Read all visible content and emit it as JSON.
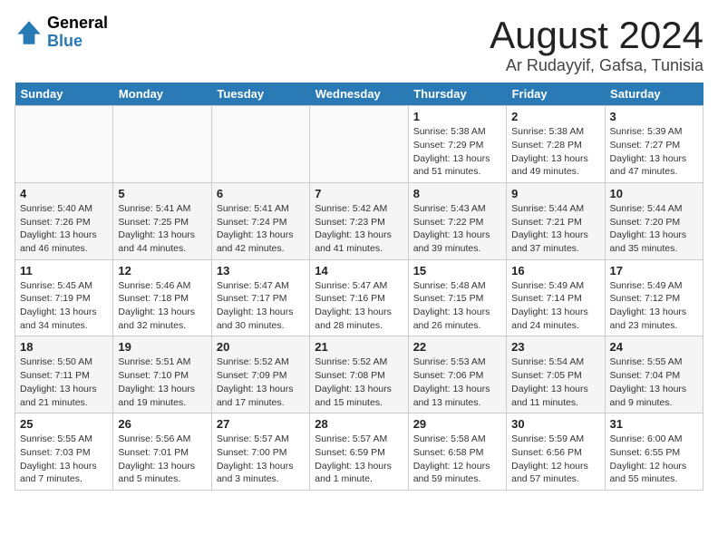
{
  "header": {
    "logo_general": "General",
    "logo_blue": "Blue",
    "month_year": "August 2024",
    "location": "Ar Rudayyif, Gafsa, Tunisia"
  },
  "days_of_week": [
    "Sunday",
    "Monday",
    "Tuesday",
    "Wednesday",
    "Thursday",
    "Friday",
    "Saturday"
  ],
  "weeks": [
    [
      {
        "day": "",
        "detail": ""
      },
      {
        "day": "",
        "detail": ""
      },
      {
        "day": "",
        "detail": ""
      },
      {
        "day": "",
        "detail": ""
      },
      {
        "day": "1",
        "detail": "Sunrise: 5:38 AM\nSunset: 7:29 PM\nDaylight: 13 hours and 51 minutes."
      },
      {
        "day": "2",
        "detail": "Sunrise: 5:38 AM\nSunset: 7:28 PM\nDaylight: 13 hours and 49 minutes."
      },
      {
        "day": "3",
        "detail": "Sunrise: 5:39 AM\nSunset: 7:27 PM\nDaylight: 13 hours and 47 minutes."
      }
    ],
    [
      {
        "day": "4",
        "detail": "Sunrise: 5:40 AM\nSunset: 7:26 PM\nDaylight: 13 hours and 46 minutes."
      },
      {
        "day": "5",
        "detail": "Sunrise: 5:41 AM\nSunset: 7:25 PM\nDaylight: 13 hours and 44 minutes."
      },
      {
        "day": "6",
        "detail": "Sunrise: 5:41 AM\nSunset: 7:24 PM\nDaylight: 13 hours and 42 minutes."
      },
      {
        "day": "7",
        "detail": "Sunrise: 5:42 AM\nSunset: 7:23 PM\nDaylight: 13 hours and 41 minutes."
      },
      {
        "day": "8",
        "detail": "Sunrise: 5:43 AM\nSunset: 7:22 PM\nDaylight: 13 hours and 39 minutes."
      },
      {
        "day": "9",
        "detail": "Sunrise: 5:44 AM\nSunset: 7:21 PM\nDaylight: 13 hours and 37 minutes."
      },
      {
        "day": "10",
        "detail": "Sunrise: 5:44 AM\nSunset: 7:20 PM\nDaylight: 13 hours and 35 minutes."
      }
    ],
    [
      {
        "day": "11",
        "detail": "Sunrise: 5:45 AM\nSunset: 7:19 PM\nDaylight: 13 hours and 34 minutes."
      },
      {
        "day": "12",
        "detail": "Sunrise: 5:46 AM\nSunset: 7:18 PM\nDaylight: 13 hours and 32 minutes."
      },
      {
        "day": "13",
        "detail": "Sunrise: 5:47 AM\nSunset: 7:17 PM\nDaylight: 13 hours and 30 minutes."
      },
      {
        "day": "14",
        "detail": "Sunrise: 5:47 AM\nSunset: 7:16 PM\nDaylight: 13 hours and 28 minutes."
      },
      {
        "day": "15",
        "detail": "Sunrise: 5:48 AM\nSunset: 7:15 PM\nDaylight: 13 hours and 26 minutes."
      },
      {
        "day": "16",
        "detail": "Sunrise: 5:49 AM\nSunset: 7:14 PM\nDaylight: 13 hours and 24 minutes."
      },
      {
        "day": "17",
        "detail": "Sunrise: 5:49 AM\nSunset: 7:12 PM\nDaylight: 13 hours and 23 minutes."
      }
    ],
    [
      {
        "day": "18",
        "detail": "Sunrise: 5:50 AM\nSunset: 7:11 PM\nDaylight: 13 hours and 21 minutes."
      },
      {
        "day": "19",
        "detail": "Sunrise: 5:51 AM\nSunset: 7:10 PM\nDaylight: 13 hours and 19 minutes."
      },
      {
        "day": "20",
        "detail": "Sunrise: 5:52 AM\nSunset: 7:09 PM\nDaylight: 13 hours and 17 minutes."
      },
      {
        "day": "21",
        "detail": "Sunrise: 5:52 AM\nSunset: 7:08 PM\nDaylight: 13 hours and 15 minutes."
      },
      {
        "day": "22",
        "detail": "Sunrise: 5:53 AM\nSunset: 7:06 PM\nDaylight: 13 hours and 13 minutes."
      },
      {
        "day": "23",
        "detail": "Sunrise: 5:54 AM\nSunset: 7:05 PM\nDaylight: 13 hours and 11 minutes."
      },
      {
        "day": "24",
        "detail": "Sunrise: 5:55 AM\nSunset: 7:04 PM\nDaylight: 13 hours and 9 minutes."
      }
    ],
    [
      {
        "day": "25",
        "detail": "Sunrise: 5:55 AM\nSunset: 7:03 PM\nDaylight: 13 hours and 7 minutes."
      },
      {
        "day": "26",
        "detail": "Sunrise: 5:56 AM\nSunset: 7:01 PM\nDaylight: 13 hours and 5 minutes."
      },
      {
        "day": "27",
        "detail": "Sunrise: 5:57 AM\nSunset: 7:00 PM\nDaylight: 13 hours and 3 minutes."
      },
      {
        "day": "28",
        "detail": "Sunrise: 5:57 AM\nSunset: 6:59 PM\nDaylight: 13 hours and 1 minute."
      },
      {
        "day": "29",
        "detail": "Sunrise: 5:58 AM\nSunset: 6:58 PM\nDaylight: 12 hours and 59 minutes."
      },
      {
        "day": "30",
        "detail": "Sunrise: 5:59 AM\nSunset: 6:56 PM\nDaylight: 12 hours and 57 minutes."
      },
      {
        "day": "31",
        "detail": "Sunrise: 6:00 AM\nSunset: 6:55 PM\nDaylight: 12 hours and 55 minutes."
      }
    ]
  ]
}
